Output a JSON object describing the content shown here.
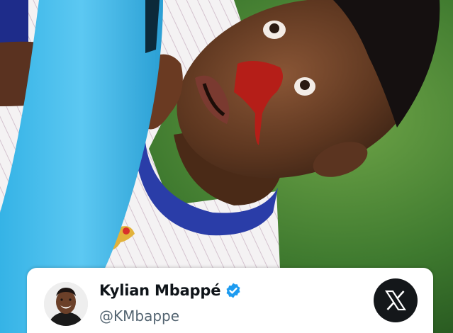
{
  "tweet": {
    "display_name": "Kylian Mbappé",
    "handle": "@KMbappe",
    "verified": true,
    "avatar_icon": "profile-avatar",
    "platform_icon": "x-logo-icon"
  },
  "colors": {
    "card_background": "#ffffff",
    "name_text": "#0f1419",
    "handle_text": "#536471",
    "verified_badge": "#1d9bf0",
    "x_logo_background": "#14171a",
    "pitch_green": "#3b6d2e"
  }
}
